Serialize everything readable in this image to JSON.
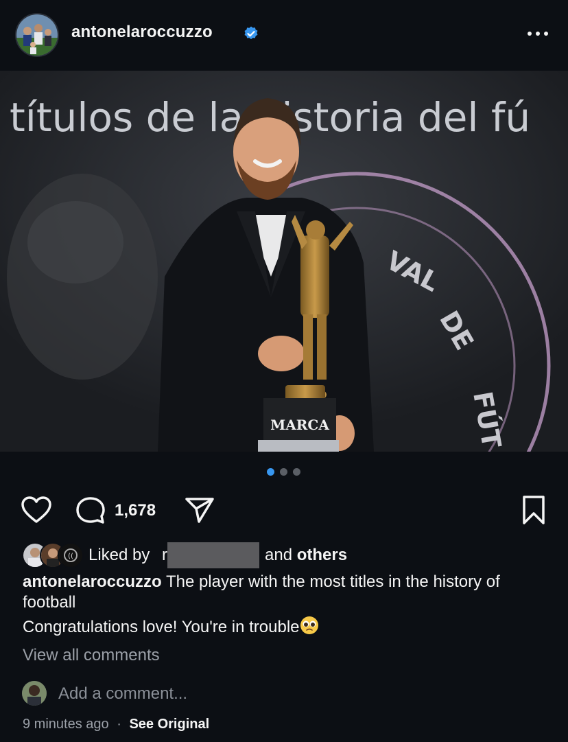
{
  "post": {
    "username": "antonelaroccuzzo",
    "verified": true,
    "more_icon": "more-horizontal-icon"
  },
  "photo": {
    "backdrop_text": "títulos de la historia del fú",
    "trophy_label": "MARCA",
    "carousel_count": 3,
    "carousel_active_index": 0
  },
  "actions": {
    "like_icon": "heart-icon",
    "comment_icon": "comment-bubble-icon",
    "comment_count": "1,678",
    "share_icon": "send-icon",
    "save_icon": "bookmark-icon"
  },
  "likes": {
    "prefix": "Liked by",
    "redacted_name": "r",
    "suffix_and": "and",
    "suffix_others": "others"
  },
  "caption": {
    "author": "antonelaroccuzzo",
    "text": "The player with the most titles in the history of football",
    "line2": "Congratulations love! You're in trouble",
    "line2_emoji": "pleading-face-emoji"
  },
  "comments": {
    "view_all": "View all comments",
    "add_placeholder": "Add a comment..."
  },
  "footer": {
    "time": "9 minutes ago",
    "separator": "·",
    "see_original": "See Original"
  },
  "colors": {
    "background": "#0c0f14",
    "verified_blue": "#3897f0",
    "carousel_active": "#3897f0",
    "muted_text": "#9ba0a8"
  }
}
